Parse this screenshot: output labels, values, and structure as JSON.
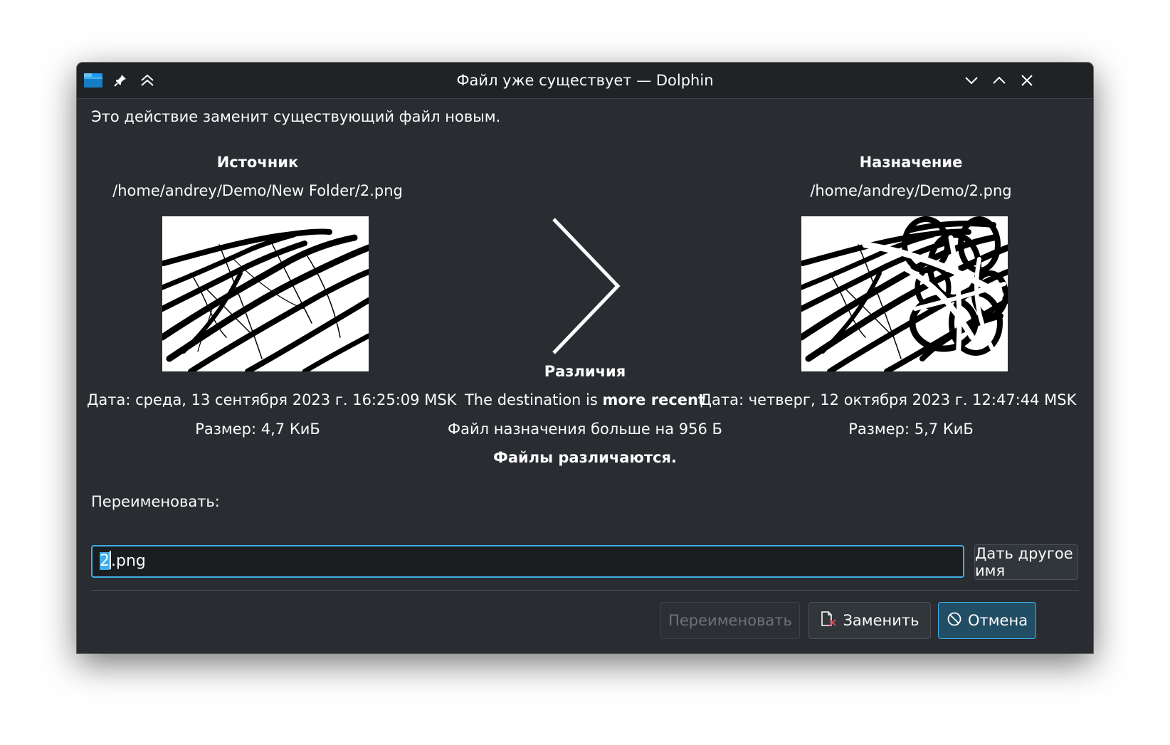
{
  "window": {
    "title": "Файл уже существует — Dolphin"
  },
  "message": "Это действие заменит существующий файл новым.",
  "source": {
    "heading": "Источник",
    "path": "/home/andrey/Demo/New Folder/2.png",
    "date": "Дата: среда, 13 сентября 2023 г. 16:25:09 MSK",
    "size": "Размер: 4,7 КиБ"
  },
  "destination": {
    "heading": "Назначение",
    "path": "/home/andrey/Demo/2.png",
    "date": "Дата: четверг, 12 октября 2023 г. 12:47:44 MSK",
    "size": "Размер: 5,7 КиБ"
  },
  "differences": {
    "heading": "Различия",
    "recent_prefix": "The destination is",
    "recent_bold": "more recent",
    "size_diff": "Файл назначения больше на 956 Б",
    "summary": "Файлы различаются."
  },
  "rename": {
    "label": "Переименовать:",
    "value_selected": "2",
    "value_rest": ".png",
    "suggest_button": "Дать другое имя"
  },
  "buttons": {
    "rename": "Переименовать",
    "replace": "Заменить",
    "cancel": "Отмена"
  },
  "colors": {
    "accent": "#3daee9",
    "background": "#292c30",
    "titlebar": "#202326",
    "text": "#fcfcfc"
  }
}
